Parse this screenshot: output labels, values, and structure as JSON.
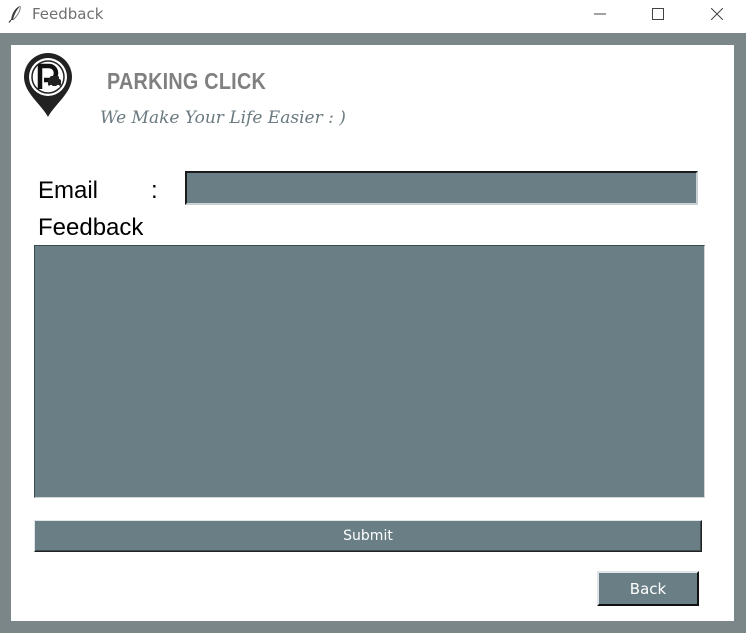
{
  "window": {
    "title": "Feedback",
    "icon": "feather-icon",
    "controls": [
      "minimize-icon",
      "maximize-icon",
      "close-icon"
    ]
  },
  "brand": {
    "logo_icon": "parking-pin-logo",
    "name": "PARKING CLICK",
    "tagline": "We Make Your Life Easier : )"
  },
  "form": {
    "email_label": "Email",
    "colon": ":",
    "email_value": "",
    "feedback_label": "Feedback",
    "feedback_value": "",
    "submit_label": "Submit",
    "back_label": "Back"
  },
  "colors": {
    "frame": "#7a8688",
    "field": "#6a7e86",
    "brand_text": "#808080"
  }
}
